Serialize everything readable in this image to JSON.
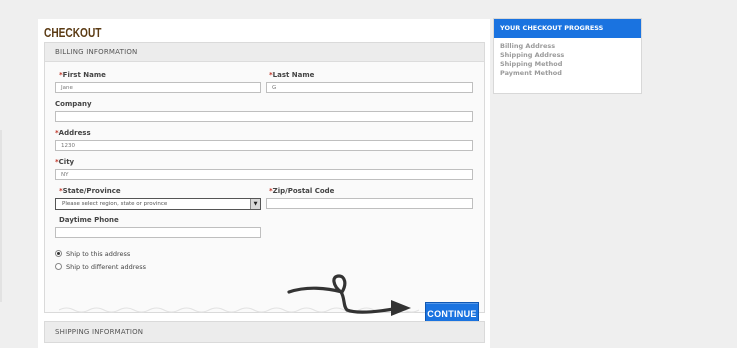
{
  "page_title": "CHECKOUT",
  "billing": {
    "header": "BILLING INFORMATION",
    "required_mark": "*",
    "first_name": {
      "label": "First Name",
      "value": "Jane"
    },
    "last_name": {
      "label": "Last Name",
      "value": "G"
    },
    "company": {
      "label": "Company",
      "value": ""
    },
    "address": {
      "label": "Address",
      "value": "1230"
    },
    "city": {
      "label": "City",
      "value": "NY"
    },
    "state": {
      "label": "State/Province",
      "selected": "Please select region, state or province"
    },
    "zip": {
      "label": "Zip/Postal Code",
      "value": ""
    },
    "phone": {
      "label": "Daytime Phone",
      "value": ""
    },
    "ship_options": [
      {
        "label": "Ship to this address",
        "checked": true
      },
      {
        "label": "Ship to different address",
        "checked": false
      }
    ],
    "continue_label": "CONTINUE"
  },
  "shipping": {
    "header": "SHIPPING INFORMATION"
  },
  "progress": {
    "title": "YOUR CHECKOUT PROGRESS",
    "steps": [
      "Billing Address",
      "Shipping Address",
      "Shipping Method",
      "Payment Method"
    ]
  },
  "colors": {
    "accent": "#1a73e0",
    "title": "#5b3b14",
    "required": "#c0392b"
  },
  "icons": {
    "dropdown": "chevron-down-icon",
    "doodle": "arrow-doodle-icon"
  }
}
